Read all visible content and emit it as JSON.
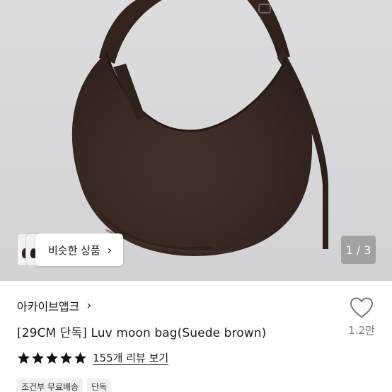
{
  "gallery": {
    "similar_label": "비슷한 상품",
    "similar_chevron": "›",
    "counter": "1 / 3"
  },
  "product": {
    "brand": "아카이브앱크",
    "brand_chevron": "›",
    "title": "[29CM 단독] Luv moon bag(Suede brown)",
    "rating_stars": 5,
    "review_link": "155개 리뷰 보기",
    "tags": [
      "조건부 무료배송",
      "단독"
    ]
  },
  "like": {
    "icon": "heart-outline-icon",
    "count": "1.2만"
  },
  "colors": {
    "star": "#111111",
    "bag": "#3b2a23",
    "background": "#d8d8da"
  }
}
